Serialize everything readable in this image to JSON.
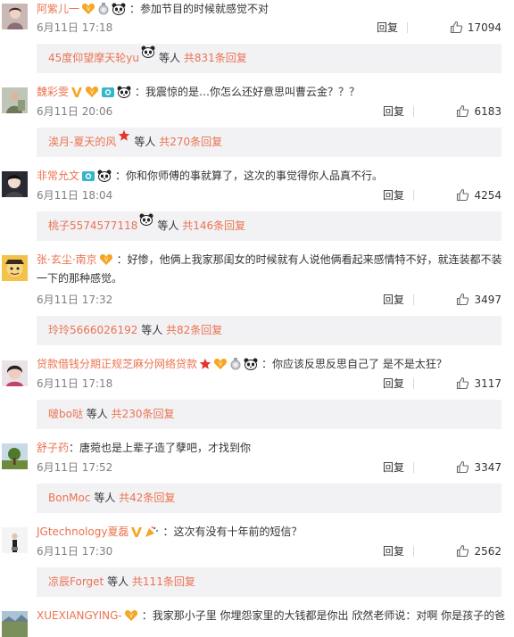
{
  "comments": [
    {
      "user": "阿紫儿一",
      "colon": "：",
      "text": "参加节目的时候就感觉不对",
      "date": "6月11日 17:18",
      "reply_label": "回复",
      "likes": "17094",
      "badges": [
        "vip-heart-icon",
        "medal-icon",
        "panda-icon"
      ],
      "sub": {
        "name": "45度仰望摩天轮yu",
        "mid": "等人",
        "count": "共831条回复",
        "badge": "panda-icon"
      }
    },
    {
      "user": "魏彩雯",
      "colon": "：",
      "text": "我震惊的是…你怎么还好意思叫曹云金？？？",
      "date": "6月11日 20:06",
      "reply_label": "回复",
      "likes": "6183",
      "badges": [
        "verified-v-icon",
        "vip-heart-icon",
        "camera-icon",
        "panda-icon"
      ],
      "sub": {
        "name": "涘月-夏天的风",
        "mid": "等人",
        "count": "共270条回复",
        "badge": "star-icon"
      }
    },
    {
      "user": "非常允文",
      "colon": "：",
      "text": "你和你师傅的事就算了，这次的事觉得你人品真不行。",
      "date": "6月11日 18:04",
      "reply_label": "回复",
      "likes": "4254",
      "badges": [
        "camera-icon",
        "panda-icon"
      ],
      "sub": {
        "name": "桃子5574577118",
        "mid": "等人",
        "count": "共146条回复",
        "badge": "panda-icon"
      }
    },
    {
      "user": "张·玄尘·南京",
      "colon": "：",
      "text": "好惨，他俩上我家那闺女的时候就有人说他俩看起来感情特不好，就连装都不装一下的那种感觉。",
      "date": "6月11日 17:32",
      "reply_label": "回复",
      "likes": "3497",
      "badges": [
        "vip-heart-icon"
      ],
      "sub": {
        "name": "玲玲5666026192",
        "mid": "等人",
        "count": "共82条回复",
        "badge": ""
      }
    },
    {
      "user": "贷款借钱分期正规芝麻分网络贷款",
      "colon": "：",
      "text": "你应该反思反思自己了 是不是太狂？",
      "date": "6月11日 17:18",
      "reply_label": "回复",
      "likes": "3117",
      "badges": [
        "star-icon",
        "vip-heart-icon",
        "medal-icon",
        "panda-icon"
      ],
      "sub": {
        "name": "啵bo哒",
        "mid": "等人",
        "count": "共230条回复",
        "badge": ""
      }
    },
    {
      "user": "舒子药",
      "colon": "：",
      "text": "唐菀也是上辈子造了孽吧，才找到你",
      "date": "6月11日 17:52",
      "reply_label": "回复",
      "likes": "3347",
      "badges": [],
      "sub": {
        "name": "BonMoc",
        "mid": "等人",
        "count": "共42条回复",
        "badge": ""
      }
    },
    {
      "user": "JGtechnology夏磊",
      "colon": "：",
      "text": "这次有没有十年前的短信？",
      "date": "6月11日 17:30",
      "reply_label": "回复",
      "likes": "2562",
      "badges": [
        "verified-v-icon",
        "party-icon"
      ],
      "sub": {
        "name": "凉辰Forget",
        "mid": "等人",
        "count": "共111条回复",
        "badge": ""
      }
    },
    {
      "user": "XUEXIANGYING-",
      "colon": "：",
      "text": "我家那小子里 你埋怨家里的大钱都是你出 欣然老师说：对啊 你是孩子的爸",
      "date": "",
      "reply_label": "",
      "likes": "",
      "badges": [
        "vip-heart-icon"
      ],
      "sub": null
    }
  ]
}
